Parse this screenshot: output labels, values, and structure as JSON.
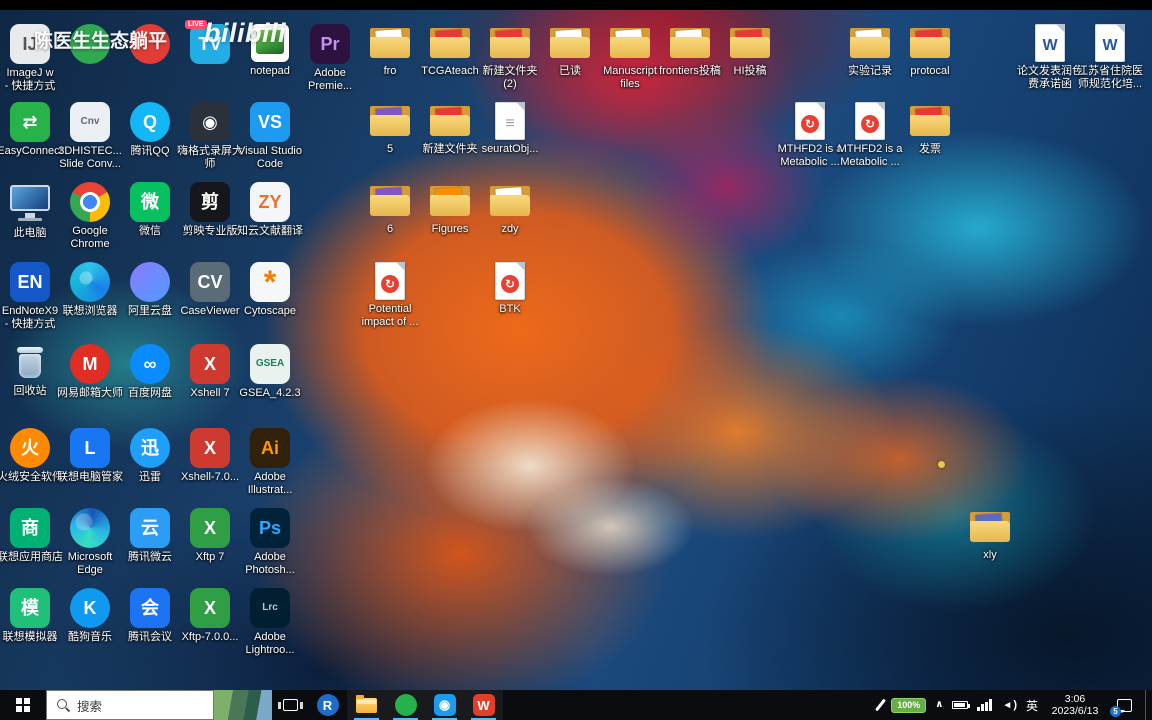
{
  "watermark": {
    "channel_name": "陈医生生态躺平",
    "platform_logo": "bilibili"
  },
  "desktop": {
    "icons": [
      {
        "id": "imagej",
        "col": 0,
        "row": 0,
        "kind": "app",
        "bg": "#e8eaed",
        "fg": "#555555",
        "glyph": "IJ",
        "label": "ImageJ w\n- 快捷方式"
      },
      {
        "id": "green-circle-app",
        "col": 1,
        "row": 0,
        "kind": "circle",
        "bg": "#2fa84f",
        "glyph": "",
        "label": ""
      },
      {
        "id": "red-circle-app",
        "col": 2,
        "row": 0,
        "kind": "circle",
        "bg": "#e23c36",
        "glyph": "",
        "label": ""
      },
      {
        "id": "bilibili-live",
        "col": 3,
        "row": 0,
        "kind": "app",
        "bg": "#23ade5",
        "fg": "#ffffff",
        "glyph": "TV",
        "badge": "LIVE",
        "label": ""
      },
      {
        "id": "notepad",
        "col": 4,
        "row": 0,
        "kind": "pic",
        "label": "notepad"
      },
      {
        "id": "adobe-premiere",
        "col": 5,
        "row": 0,
        "kind": "app",
        "bg": "#2d1240",
        "fg": "#c490f5",
        "glyph": "Pr",
        "label": "Adobe\nPremie..."
      },
      {
        "id": "folder-fro",
        "col": 6,
        "row": 0,
        "kind": "folder",
        "paper": "#ffffff",
        "label": "fro"
      },
      {
        "id": "folder-tcgateach",
        "col": 7,
        "row": 0,
        "kind": "folder",
        "paper": "#e53935",
        "label": "TCGAteach"
      },
      {
        "id": "folder-new-2",
        "col": 8,
        "row": 0,
        "kind": "folder",
        "paper": "#e53935",
        "label": "新建文件夹\n(2)"
      },
      {
        "id": "folder-read",
        "col": 9,
        "row": 0,
        "kind": "folder",
        "paper": "#ffffff",
        "label": "已读"
      },
      {
        "id": "folder-manuscript",
        "col": 10,
        "row": 0,
        "kind": "folder",
        "paper": "#ffffff",
        "label": "Manuscript\nfiles"
      },
      {
        "id": "folder-frontiers",
        "col": 11,
        "row": 0,
        "kind": "folder",
        "paper": "#ffffff",
        "label": "frontiers投稿"
      },
      {
        "id": "folder-hi",
        "col": 12,
        "row": 0,
        "kind": "folder",
        "paper": "#e53935",
        "label": "HI投稿"
      },
      {
        "id": "folder-lab-record",
        "col": 14,
        "row": 0,
        "kind": "folder",
        "paper": "#ffffff",
        "label": "实验记录"
      },
      {
        "id": "folder-protocal",
        "col": 15,
        "row": 0,
        "kind": "folder",
        "paper": "#e53935",
        "label": "protocal"
      },
      {
        "id": "doc-retouching-fee",
        "col": 17,
        "row": 0,
        "kind": "doc",
        "glyph": "W",
        "label": "论文发表润色\n费承诺函"
      },
      {
        "id": "doc-jiangsu-training",
        "col": 18,
        "row": 0,
        "kind": "doc",
        "glyph": "W",
        "label": "江苏省住院医\n师规范化培..."
      },
      {
        "id": "easyconnect",
        "col": 0,
        "row": 1,
        "kind": "app",
        "bg": "#27b24a",
        "fg": "#ffffff",
        "glyph": "⇄",
        "label": "EasyConnect"
      },
      {
        "id": "slide-converter",
        "col": 1,
        "row": 1,
        "kind": "app",
        "bg": "#eceff3",
        "fg": "#5d6a77",
        "glyph": "Cnv",
        "label": "3DHISTEC...\nSlide Conv..."
      },
      {
        "id": "tencent-qq",
        "col": 2,
        "row": 1,
        "kind": "circle",
        "bg": "#14b7f5",
        "fg": "#ffffff",
        "glyph": "Q",
        "label": "腾讯QQ"
      },
      {
        "id": "higeshi-recorder",
        "col": 3,
        "row": 1,
        "kind": "app",
        "bg": "#2b313b",
        "fg": "#ffffff",
        "glyph": "◉",
        "label": "嗨格式录屏大\n师"
      },
      {
        "id": "vscode",
        "col": 4,
        "row": 1,
        "kind": "app",
        "bg": "#1d9bf0",
        "fg": "#ffffff",
        "glyph": "VS",
        "label": "Visual Studio\nCode"
      },
      {
        "id": "folder-5",
        "col": 6,
        "row": 1,
        "kind": "folder",
        "paper": "#7e57c2",
        "label": "5"
      },
      {
        "id": "folder-new",
        "col": 7,
        "row": 1,
        "kind": "folder",
        "paper": "#e53935",
        "label": "新建文件夹"
      },
      {
        "id": "doc-seurat",
        "col": 8,
        "row": 1,
        "kind": "doc",
        "glyph": "≡",
        "fg": "#9aa4ae",
        "label": "seuratObj..."
      },
      {
        "id": "pdf-mthfd2-1",
        "col": 13,
        "row": 1,
        "kind": "pdf",
        "glyph": "↻",
        "label": "MTHFD2 is a\nMetabolic ..."
      },
      {
        "id": "pdf-mthfd2-2",
        "col": 14,
        "row": 1,
        "kind": "pdf",
        "glyph": "↻",
        "label": "MTHFD2 is a\nMetabolic ..."
      },
      {
        "id": "folder-invoice",
        "col": 15,
        "row": 1,
        "kind": "folder",
        "paper": "#e53935",
        "label": "发票"
      },
      {
        "id": "this-pc",
        "col": 0,
        "row": 2,
        "kind": "pc",
        "label": "此电脑"
      },
      {
        "id": "google-chrome",
        "col": 1,
        "row": 2,
        "kind": "chrome",
        "label": "Google\nChrome"
      },
      {
        "id": "wechat",
        "col": 2,
        "row": 2,
        "kind": "app",
        "bg": "#07c160",
        "fg": "#ffffff",
        "glyph": "微",
        "label": "微信"
      },
      {
        "id": "jianying-pro",
        "col": 3,
        "row": 2,
        "kind": "app",
        "bg": "#15171c",
        "fg": "#ffffff",
        "glyph": "剪",
        "label": "剪映专业版"
      },
      {
        "id": "zhiyun-translate",
        "col": 4,
        "row": 2,
        "kind": "app",
        "bg": "#f4f6f8",
        "fg": "#e8712b",
        "glyph": "ZY",
        "label": "知云文献翻译"
      },
      {
        "id": "folder-6",
        "col": 6,
        "row": 2,
        "kind": "folder",
        "paper": "#7e57c2",
        "label": "6"
      },
      {
        "id": "folder-figures",
        "col": 7,
        "row": 2,
        "kind": "folder",
        "paper": "#fb8c00",
        "label": "Figures"
      },
      {
        "id": "folder-zdy",
        "col": 8,
        "row": 2,
        "kind": "folder",
        "paper": "#ffffff",
        "label": "zdy"
      },
      {
        "id": "endnote",
        "col": 0,
        "row": 3,
        "kind": "app",
        "bg": "#1458c8",
        "fg": "#ffffff",
        "glyph": "EN",
        "label": "EndNoteX9\n- 快捷方式"
      },
      {
        "id": "lenovo-browser",
        "col": 1,
        "row": 3,
        "kind": "swirl",
        "label": "联想浏览器"
      },
      {
        "id": "aliyun-drive",
        "col": 2,
        "row": 3,
        "kind": "circle",
        "bg": "linear-gradient(135deg,#8b7bff,#4e9bff)",
        "glyph": "",
        "label": "阿里云盘"
      },
      {
        "id": "caseviewer",
        "col": 3,
        "row": 3,
        "kind": "app",
        "bg": "#5b6b78",
        "fg": "#ffffff",
        "glyph": "CV",
        "label": "CaseViewer"
      },
      {
        "id": "cytoscape",
        "col": 4,
        "row": 3,
        "kind": "app",
        "bg": "#f6f7f8",
        "fg": "#f57c00",
        "glyph": "*",
        "gsize": "32px",
        "label": "Cytoscape"
      },
      {
        "id": "pdf-potential-impact",
        "col": 6,
        "row": 3,
        "kind": "pdf",
        "glyph": "↻",
        "label": "Potential\nimpact of ..."
      },
      {
        "id": "pdf-btk",
        "col": 8,
        "row": 3,
        "kind": "pdf",
        "glyph": "↻",
        "label": "BTK"
      },
      {
        "id": "recycle-bin",
        "col": 0,
        "row": 4,
        "kind": "bin",
        "label": "回收站"
      },
      {
        "id": "netease-mail-master",
        "col": 1,
        "row": 4,
        "kind": "circle",
        "bg": "#e02e24",
        "fg": "#ffffff",
        "glyph": "M",
        "label": "网易邮箱大师"
      },
      {
        "id": "baidu-netdisk",
        "col": 2,
        "row": 4,
        "kind": "circle",
        "bg": "#0a8cff",
        "fg": "#ffffff",
        "glyph": "∞",
        "label": "百度网盘"
      },
      {
        "id": "xshell-7",
        "col": 3,
        "row": 4,
        "kind": "app",
        "bg": "#cf3a30",
        "fg": "#ffffff",
        "glyph": "X",
        "label": "Xshell 7"
      },
      {
        "id": "gsea",
        "col": 4,
        "row": 4,
        "kind": "app",
        "bg": "#e9f2ee",
        "fg": "#1b7f5c",
        "glyph": "GSEA",
        "label": "GSEA_4.2.3"
      },
      {
        "id": "huorong-security",
        "col": 0,
        "row": 5,
        "kind": "circle",
        "bg": "#ff8a00",
        "fg": "#ffffff",
        "glyph": "火",
        "label": "火绒安全软件"
      },
      {
        "id": "lenovo-pc-manager",
        "col": 1,
        "row": 5,
        "kind": "app",
        "bg": "#1976f2",
        "fg": "#ffffff",
        "glyph": "L",
        "label": "联想电脑管家"
      },
      {
        "id": "xunlei",
        "col": 2,
        "row": 5,
        "kind": "circle",
        "bg": "#1ea0fa",
        "fg": "#ffffff",
        "glyph": "迅",
        "label": "迅雷"
      },
      {
        "id": "xshell-7-installer",
        "col": 3,
        "row": 5,
        "kind": "app",
        "bg": "#cf3a30",
        "fg": "#ffffff",
        "glyph": "X",
        "label": "Xshell-7.0..."
      },
      {
        "id": "adobe-illustrator",
        "col": 4,
        "row": 5,
        "kind": "app",
        "bg": "#31200a",
        "fg": "#ff9a00",
        "glyph": "Ai",
        "label": "Adobe\nIllustrat..."
      },
      {
        "id": "lenovo-app-store",
        "col": 0,
        "row": 6,
        "kind": "app",
        "bg": "#00b173",
        "fg": "#ffffff",
        "glyph": "商",
        "label": "联想应用商店"
      },
      {
        "id": "microsoft-edge",
        "col": 1,
        "row": 6,
        "kind": "edge",
        "label": "Microsoft\nEdge"
      },
      {
        "id": "tencent-weiyun",
        "col": 2,
        "row": 6,
        "kind": "app",
        "bg": "#2b9df4",
        "fg": "#ffffff",
        "glyph": "云",
        "label": "腾讯微云"
      },
      {
        "id": "xftp-7",
        "col": 3,
        "row": 6,
        "kind": "app",
        "bg": "#2f9e44",
        "fg": "#ffffff",
        "glyph": "X",
        "label": "Xftp 7"
      },
      {
        "id": "adobe-photoshop",
        "col": 4,
        "row": 6,
        "kind": "app",
        "bg": "#00233a",
        "fg": "#31a8ff",
        "glyph": "Ps",
        "label": "Adobe\nPhotosh..."
      },
      {
        "id": "folder-xly",
        "col": 16,
        "row": 6,
        "kind": "folder",
        "paper": "#5c6bc0",
        "label": "xly"
      },
      {
        "id": "lenovo-emulator",
        "col": 0,
        "row": 7,
        "kind": "app",
        "bg": "#21c07a",
        "fg": "#ffffff",
        "glyph": "模",
        "label": "联想模拟器"
      },
      {
        "id": "kugou-music",
        "col": 1,
        "row": 7,
        "kind": "circle",
        "bg": "#0f9af0",
        "fg": "#ffffff",
        "glyph": "K",
        "label": "酷狗音乐"
      },
      {
        "id": "tencent-meeting",
        "col": 2,
        "row": 7,
        "kind": "app",
        "bg": "#1d74f2",
        "fg": "#ffffff",
        "glyph": "会",
        "label": "腾讯会议"
      },
      {
        "id": "xftp-7-installer",
        "col": 3,
        "row": 7,
        "kind": "app",
        "bg": "#2f9e44",
        "fg": "#ffffff",
        "glyph": "X",
        "label": "Xftp-7.0.0..."
      },
      {
        "id": "adobe-lightroom",
        "col": 4,
        "row": 7,
        "kind": "app",
        "bg": "#002032",
        "fg": "#8fd6f8",
        "glyph": "Lrc",
        "label": "Adobe\nLightroo..."
      }
    ]
  },
  "taskbar": {
    "search_placeholder": "搜索",
    "apps": [
      {
        "id": "r",
        "kind": "circle",
        "bg": "#1e6cc8",
        "fg": "#ffffff",
        "glyph": "R",
        "running": false
      },
      {
        "id": "file-explorer",
        "kind": "folder",
        "running": true
      },
      {
        "id": "green-app",
        "kind": "circle",
        "bg": "#25b14b",
        "fg": "#ffffff",
        "glyph": "",
        "running": true
      },
      {
        "id": "screen-recorder",
        "kind": "app",
        "bg": "#1d9bf0",
        "fg": "#ffffff",
        "glyph": "◉",
        "running": true
      },
      {
        "id": "wps-office",
        "kind": "app",
        "bg": "#e23f2b",
        "fg": "#ffffff",
        "glyph": "W",
        "running": true
      }
    ],
    "tray": {
      "battery_badge": "100%",
      "language_indicator": "英",
      "clock_time": "3:06",
      "clock_date": "2023/6/13",
      "notification_count": "5"
    }
  }
}
